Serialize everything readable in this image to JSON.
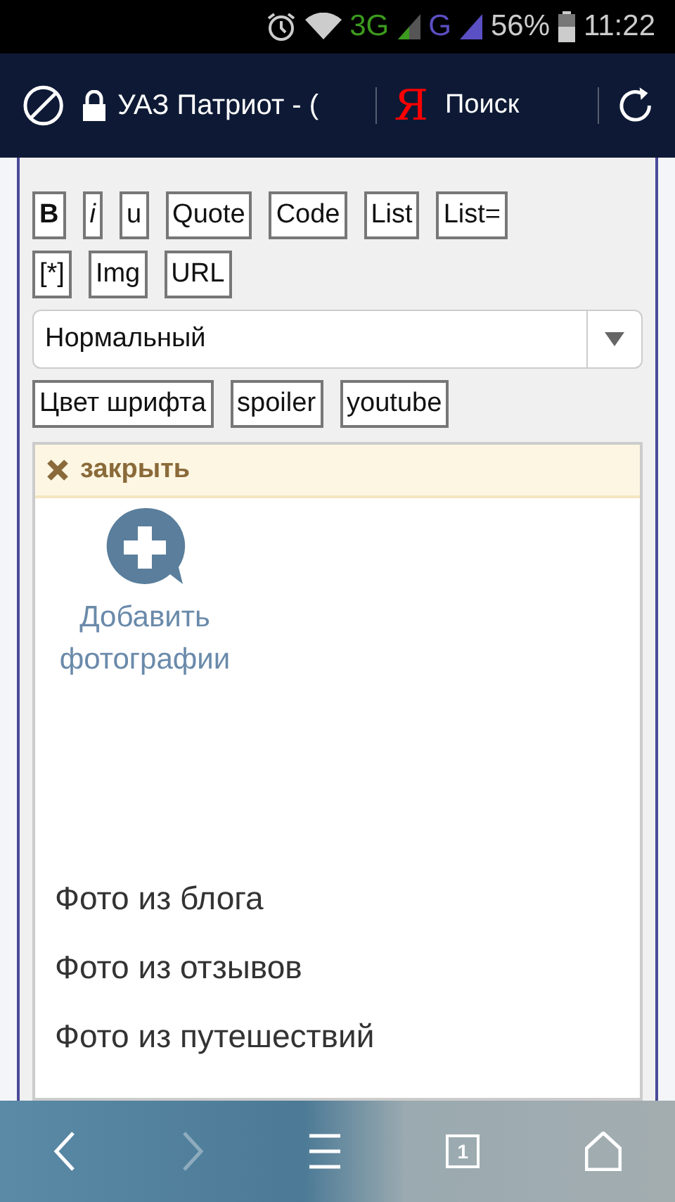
{
  "status_bar": {
    "network_1": "3G",
    "network_2": "G",
    "battery": "56%",
    "time": "11:22"
  },
  "address_bar": {
    "title": "УАЗ Патриот - (",
    "search_logo": "Я",
    "search_label": "Поиск"
  },
  "toolbar_rows": [
    {
      "buttons": [
        {
          "label": "B",
          "kind": "bold"
        },
        {
          "label": "i",
          "kind": "italic"
        },
        {
          "label": "u",
          "kind": "plain"
        },
        {
          "label": "Quote",
          "kind": "plain"
        },
        {
          "label": "Code",
          "kind": "plain"
        },
        {
          "label": "List",
          "kind": "plain"
        },
        {
          "label": "List=",
          "kind": "plain"
        }
      ]
    },
    {
      "buttons": [
        {
          "label": "[*]",
          "kind": "plain"
        },
        {
          "label": "Img",
          "kind": "plain"
        },
        {
          "label": "URL",
          "kind": "plain"
        }
      ]
    }
  ],
  "size_select": {
    "value": "Нормальный"
  },
  "extra_buttons": [
    "Цвет шрифта",
    "spoiler",
    "youtube"
  ],
  "popup": {
    "close_label": "закрыть",
    "add_photos": [
      "Добавить",
      "фотографии"
    ],
    "sources": [
      "Фото из блога",
      "Фото из отзывов",
      "Фото из путешествий"
    ]
  },
  "bottom_nav": {
    "back_disabled": false,
    "forward_disabled": true,
    "tab_count": "1"
  }
}
